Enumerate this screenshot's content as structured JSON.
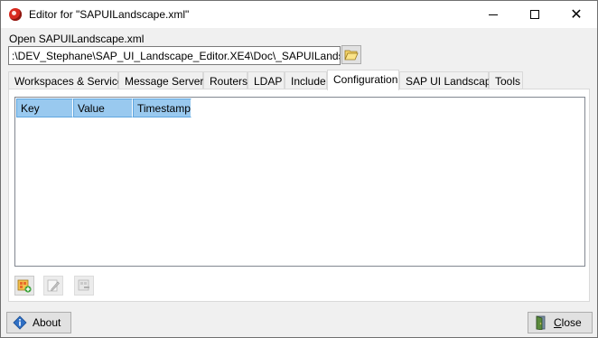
{
  "window": {
    "title": "Editor for \"SAPUILandscape.xml\"",
    "app_icon": "sap-logo-icon"
  },
  "file": {
    "open_label": "Open SAPUILandscape.xml",
    "path_value": ":\\DEV_Stephane\\SAP_UI_Landscape_Editor.XE4\\Doc\\_SAPUILandscape.xml",
    "browse_icon": "folder-open-icon"
  },
  "tabs": [
    {
      "label": "Workspaces & Services"
    },
    {
      "label": "Message Servers"
    },
    {
      "label": "Routers"
    },
    {
      "label": "LDAP"
    },
    {
      "label": "Include"
    },
    {
      "label": "Configuration"
    },
    {
      "label": "SAP UI Landscape"
    },
    {
      "label": "Tools"
    }
  ],
  "active_tab": "Configuration",
  "table": {
    "columns": [
      "Key",
      "Value",
      "Timestamp"
    ],
    "rows": []
  },
  "toolbar": {
    "add_icon": "add-entry-icon",
    "edit_icon": "edit-icon",
    "delete_icon": "delete-icon"
  },
  "footer": {
    "about_label": "About",
    "close_label": "Close"
  },
  "colors": {
    "header_selected": "#99c9ef",
    "header_border": "#5fa6df"
  }
}
